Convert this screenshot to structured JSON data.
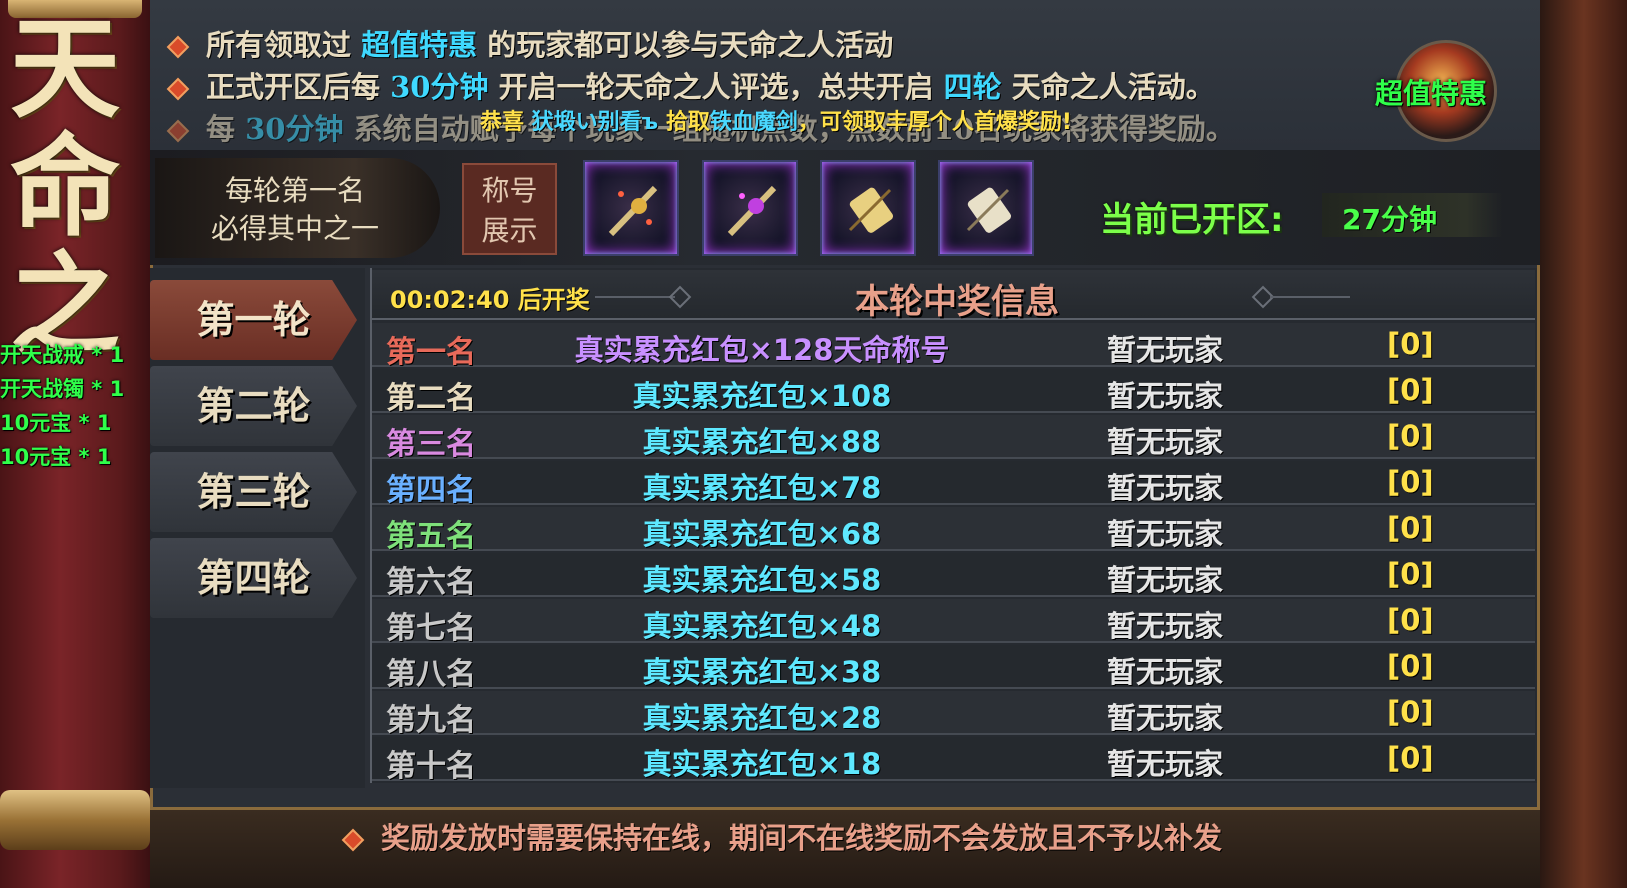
{
  "scroll": {
    "title_chars": [
      "天",
      "命",
      "之"
    ],
    "side_rewards": [
      "开天战戒 * 1",
      "开天战镯 * 1",
      "10元宝 * 1",
      "10元宝 * 1"
    ]
  },
  "info": {
    "line1": {
      "a": "所有领取过 ",
      "hl": "超值特惠",
      "b": " 的玩家都可以参与天命之人活动"
    },
    "line2": {
      "a": "正式开区后每 ",
      "hl1": "30分钟",
      "b": " 开启一轮天命之人评选，总共开启 ",
      "hl2": "四轮",
      "c": " 天命之人活动。"
    },
    "line3": {
      "a": "每 ",
      "hl": "30分钟",
      "b": " 系统自动赋予每个玩家一组随机点数，点数前10名玩家将获得奖励。"
    },
    "broadcast": {
      "a": "恭喜 ",
      "player": "犾塅い别看ъ",
      "b": " 拾取",
      "item": "铁血魔剑",
      "c": "，可领取丰厚个人首爆奖励!"
    }
  },
  "promo": {
    "label": "超值特惠"
  },
  "first_place": {
    "line1": "每轮第一名",
    "line2": "必得其中之一"
  },
  "title_show": {
    "line1": "称号",
    "line2": "展示"
  },
  "reward_items": [
    "item-slot-1",
    "item-slot-2",
    "item-slot-3",
    "item-slot-4"
  ],
  "status": {
    "label": "当前已开区:",
    "value": "27分钟"
  },
  "tabs": [
    "第一轮",
    "第二轮",
    "第三轮",
    "第四轮"
  ],
  "active_tab": 0,
  "table": {
    "countdown": "00:02:40 后开奖",
    "title": "本轮中奖信息",
    "rows": [
      {
        "rank": "第一名",
        "reward": "真实累充红包×128天命称号",
        "player": "暂无玩家",
        "count": "[0]"
      },
      {
        "rank": "第二名",
        "reward": "真实累充红包×108",
        "player": "暂无玩家",
        "count": "[0]"
      },
      {
        "rank": "第三名",
        "reward": "真实累充红包×88",
        "player": "暂无玩家",
        "count": "[0]"
      },
      {
        "rank": "第四名",
        "reward": "真实累充红包×78",
        "player": "暂无玩家",
        "count": "[0]"
      },
      {
        "rank": "第五名",
        "reward": "真实累充红包×68",
        "player": "暂无玩家",
        "count": "[0]"
      },
      {
        "rank": "第六名",
        "reward": "真实累充红包×58",
        "player": "暂无玩家",
        "count": "[0]"
      },
      {
        "rank": "第七名",
        "reward": "真实累充红包×48",
        "player": "暂无玩家",
        "count": "[0]"
      },
      {
        "rank": "第八名",
        "reward": "真实累充红包×38",
        "player": "暂无玩家",
        "count": "[0]"
      },
      {
        "rank": "第九名",
        "reward": "真实累充红包×28",
        "player": "暂无玩家",
        "count": "[0]"
      },
      {
        "rank": "第十名",
        "reward": "真实累充红包×18",
        "player": "暂无玩家",
        "count": "[0]"
      }
    ]
  },
  "footer": {
    "note": "奖励发放时需要保持在线，期间不在线奖励不会发放且不予以补发"
  },
  "colors": {
    "rank_1": "#e86a5a",
    "rank_2": "#e8dcc0",
    "rank_3": "#d98ae0",
    "rank_4": "#6ab0ff",
    "rank_5": "#7ee07a",
    "rank_default": "#c8c8c8",
    "reward_1": "#c890ff",
    "reward_default": "#5ee8ff",
    "highlight": "#3fd9ff",
    "count": "#ffe14a"
  }
}
